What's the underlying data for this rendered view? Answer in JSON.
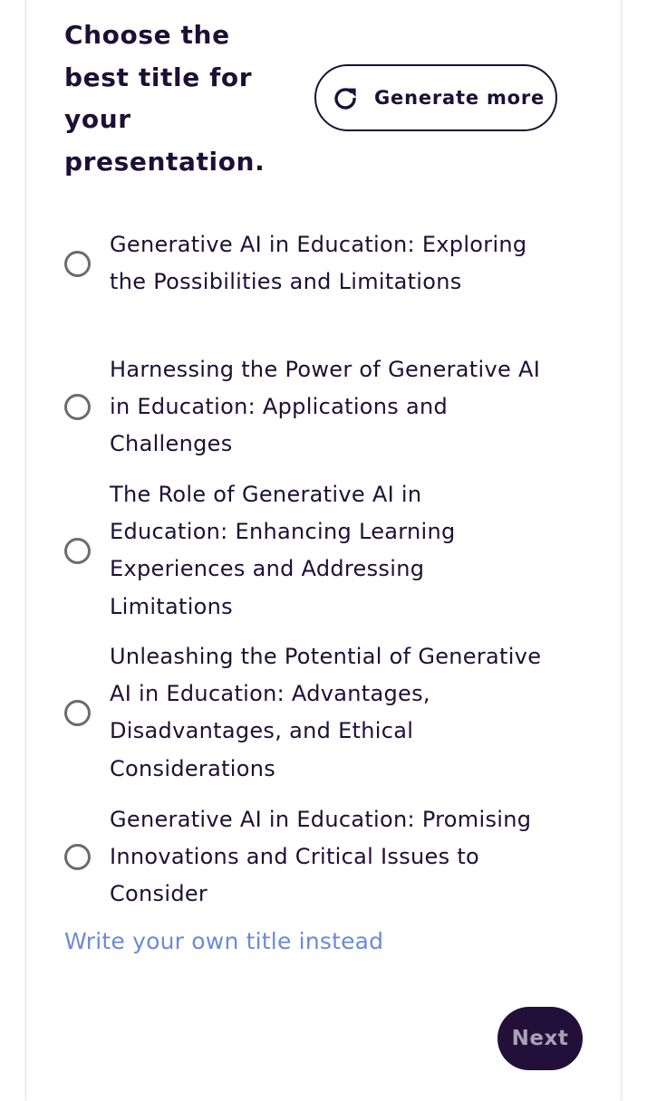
{
  "header": {
    "title": "Choose the best title for your presentation."
  },
  "generate_button": {
    "label": "Generate more",
    "icon": "refresh-icon"
  },
  "options": [
    {
      "label": "Generative AI in Education: Exploring the Possibilities and Limitations",
      "selected": false
    },
    {
      "label": "Harnessing the Power of Generative AI in Education: Applications and Challenges",
      "selected": false
    },
    {
      "label": "The Role of Generative AI in Education: Enhancing Learning Experiences and Addressing Limitations",
      "selected": false
    },
    {
      "label": "Unleashing the Potential of Generative AI in Education: Advantages, Disadvantages, and Ethical Considerations",
      "selected": false
    },
    {
      "label": "Generative AI in Education: Promising Innovations and Critical Issues to Consider",
      "selected": false
    }
  ],
  "custom_title_link": "Write your own title instead",
  "next_button": {
    "label": "Next"
  },
  "colors": {
    "text_dark": "#1e0f36",
    "link": "#6b8ad9",
    "radio_border": "#6c6c70",
    "next_bg": "#22103a",
    "next_text": "#a8a2b4"
  }
}
